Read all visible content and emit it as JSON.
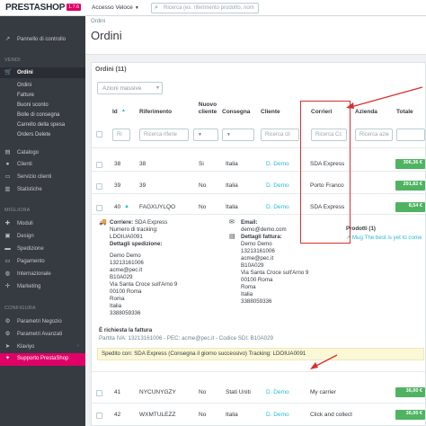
{
  "topbar": {
    "logo": "PRESTASHOP",
    "version": "1.7.6",
    "quick_access": "Accesso Veloce",
    "search_placeholder": "Ricerca (es. riferimento prodotto, nom"
  },
  "sidebar": {
    "dashboard": "Pannello di controllo",
    "sec_vendi": "VENDI",
    "orders": "Ordini",
    "orders_sub": [
      "Ordini",
      "Fatture",
      "Buoni sconto",
      "Bolle di consegna",
      "Carrello della spesa",
      "Orders Delete"
    ],
    "catalog": "Catalogo",
    "clients": "Clienti",
    "customer_service": "Servizio clienti",
    "stats": "Statistiche",
    "sec_migliora": "MIGLIORA",
    "modules": "Moduli",
    "design": "Design",
    "shipping": "Spedizione",
    "payment": "Pagamento",
    "international": "Internazionale",
    "marketing": "Marketing",
    "sec_configura": "CONFIGURA",
    "shop_params": "Parametri Negozio",
    "adv_params": "Parametri Avanzati",
    "klaviyo": "Klaviyo",
    "support": "Supporto PrestaShop"
  },
  "header": {
    "breadcrumb": "Ordini",
    "title": "Ordini"
  },
  "panel": {
    "title": "Ordini (11)",
    "bulk": "Azioni massive",
    "columns": {
      "id": "Id",
      "ref": "Riferimento",
      "new_client_1": "Nuovo",
      "new_client_2": "cliente",
      "delivery": "Consegna",
      "client": "Cliente",
      "carrier": "Corrieri",
      "company": "Azienda",
      "total": "Totale"
    },
    "filters": {
      "ref": "Ricerca riferie",
      "client": "Ricerca cli",
      "carrier": "Ricerca Cc",
      "company": "Ricerca azie",
      "id": "Ri"
    },
    "rows": [
      {
        "id": "38",
        "ref": "38",
        "new": "Si",
        "delivery": "Italia",
        "client": "D. Demo",
        "carrier": "SDA Express",
        "total": "306,36 €"
      },
      {
        "id": "39",
        "ref": "39",
        "new": "No",
        "delivery": "Italia",
        "client": "D. Demo",
        "carrier": "Porto Franco",
        "total": "291,82 €"
      },
      {
        "id": "40",
        "ref": "FAGXUYLQO",
        "new": "No",
        "delivery": "Italia",
        "client": "D. Demo",
        "carrier": "SDA Express",
        "total": "8,54 €"
      }
    ],
    "rows_bottom": [
      {
        "id": "41",
        "ref": "NYCUNYGZY",
        "new": "No",
        "delivery": "Stati Uniti",
        "client": "D. Demo",
        "carrier": "My carrier",
        "total": "36,00 €"
      },
      {
        "id": "42",
        "ref": "WXMTULEZZ",
        "new": "No",
        "delivery": "Italia",
        "client": "D. Demo",
        "carrier": "Click and collect",
        "total": "36,00 €"
      }
    ]
  },
  "detail": {
    "carrier_label": "Corriere:",
    "carrier_value": "SDA Express",
    "tracking_label": "Numero di tracking:",
    "tracking_value": "LDOIUA0091",
    "shipping_details": "Dettagli spedizione:",
    "ship_lines": [
      "Demo Demo",
      "13213161006",
      "acme@pec.it",
      "B10A029",
      "Via Santa Croce sull'Arno 9",
      "00100 Roma",
      "Roma",
      "Italia",
      "3388059336"
    ],
    "email_label": "Email:",
    "email_value": "demo@demo.com",
    "invoice_label": "Dettagli fattura:",
    "inv_lines": [
      "Demo Demo",
      "13213161006",
      "acme@pec.it",
      "B10A029",
      "Via Santa Croce sull'Arno 9",
      "00100 Roma",
      "Roma",
      "Italia",
      "3388059336"
    ],
    "products_label": "Prodotti (1)",
    "product_link": "Mug The best is yet to come",
    "invoice_request": "È richiesta la fattura",
    "partita": "Partita IVA: 13213161006 - PEC: acme@pec.it - Codice SDI: B10A029",
    "spedito": "Spedito con: SDA Express (Consegna il giorno successivo) Tracking: LDOIUA0091"
  },
  "colors": {
    "sidebar_bg": "#363a41",
    "accent": "#25b9d7",
    "brand": "#df0067",
    "status_green": "#4fb361",
    "highlight_red": "#d9302f"
  }
}
